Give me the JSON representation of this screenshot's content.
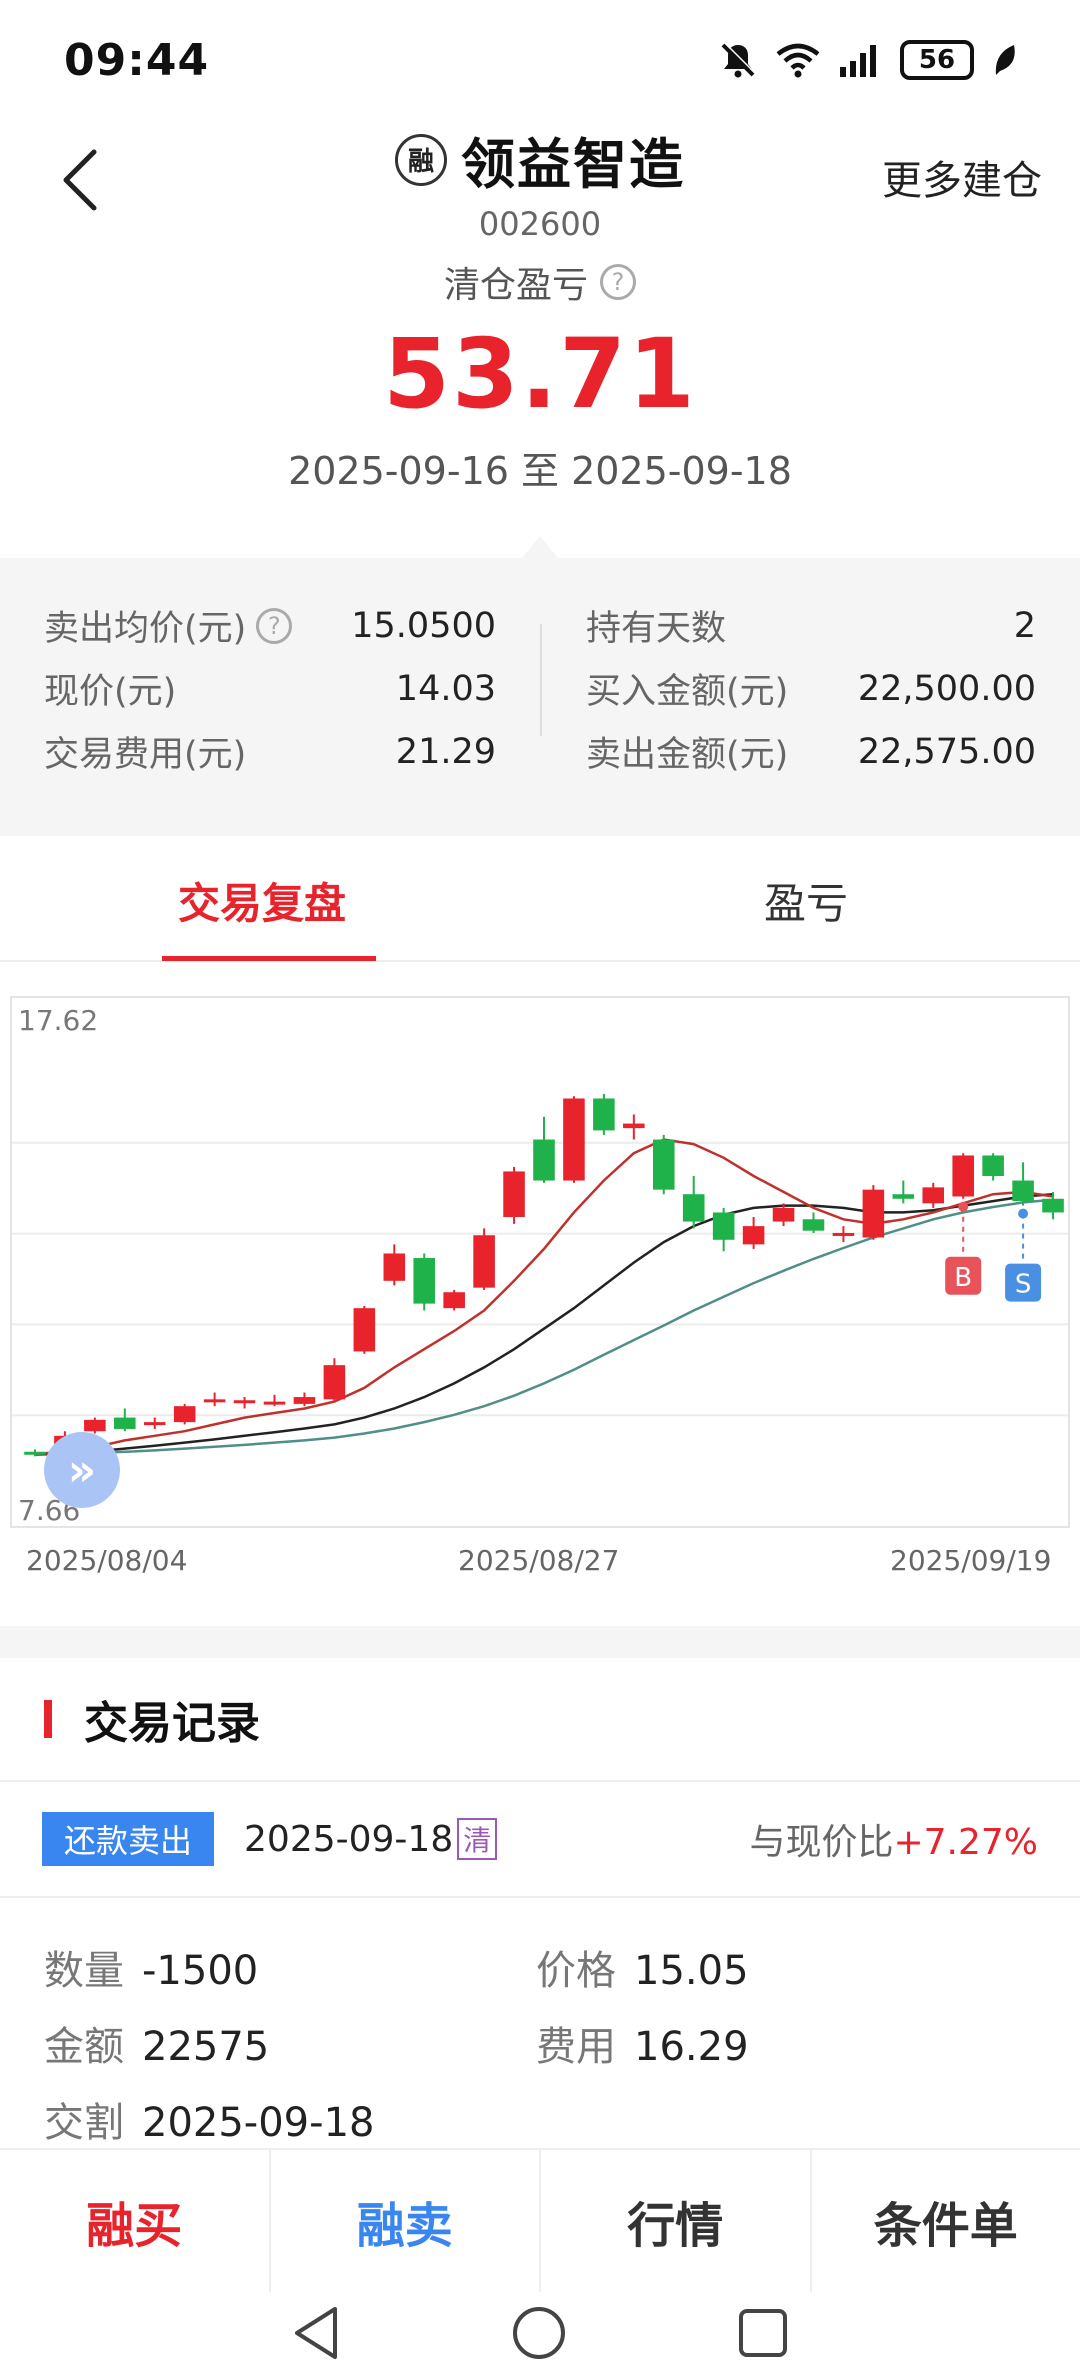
{
  "status_bar": {
    "time": "09:44",
    "battery": "56"
  },
  "header": {
    "stock_name": "领益智造",
    "stock_code": "002600",
    "seal_char": "融",
    "more_label": "更多建仓"
  },
  "summary": {
    "pl_label": "清仓盈亏",
    "pl_value": "53.71",
    "date_range": "2025-09-16 至 2025-09-18"
  },
  "stats": {
    "left": [
      {
        "label": "卖出均价(元)",
        "value": "15.0500",
        "help": true
      },
      {
        "label": "现价(元)",
        "value": "14.03"
      },
      {
        "label": "交易费用(元)",
        "value": "21.29"
      }
    ],
    "right": [
      {
        "label": "持有天数",
        "value": "2"
      },
      {
        "label": "买入金额(元)",
        "value": "22,500.00"
      },
      {
        "label": "卖出金额(元)",
        "value": "22,575.00"
      }
    ]
  },
  "tabs": {
    "replay": "交易复盘",
    "profit": "盈亏"
  },
  "chart_data": {
    "type": "candlestick",
    "ylim": [
      7.66,
      17.62
    ],
    "y_max_label": "17.62",
    "y_min_label": "7.66",
    "x_labels": [
      "2025/08/04",
      "2025/08/27",
      "2025/09/19"
    ],
    "candles": [
      {
        "o": 8.85,
        "c": 8.8,
        "h": 8.9,
        "l": 8.75
      },
      {
        "o": 8.95,
        "c": 9.2,
        "h": 9.3,
        "l": 8.9
      },
      {
        "o": 9.3,
        "c": 9.55,
        "h": 9.6,
        "l": 9.25
      },
      {
        "o": 9.6,
        "c": 9.35,
        "h": 9.8,
        "l": 9.3
      },
      {
        "o": 9.45,
        "c": 9.5,
        "h": 9.6,
        "l": 9.35
      },
      {
        "o": 9.5,
        "c": 9.85,
        "h": 9.9,
        "l": 9.45
      },
      {
        "o": 9.95,
        "c": 10.0,
        "h": 10.15,
        "l": 9.85
      },
      {
        "o": 9.95,
        "c": 9.98,
        "h": 10.05,
        "l": 9.8
      },
      {
        "o": 9.95,
        "c": 9.95,
        "h": 10.1,
        "l": 9.85
      },
      {
        "o": 9.9,
        "c": 10.05,
        "h": 10.15,
        "l": 9.85
      },
      {
        "o": 10.0,
        "c": 10.75,
        "h": 10.9,
        "l": 9.95
      },
      {
        "o": 11.05,
        "c": 12.0,
        "h": 12.05,
        "l": 11.0
      },
      {
        "o": 12.6,
        "c": 13.2,
        "h": 13.4,
        "l": 12.5
      },
      {
        "o": 13.1,
        "c": 12.1,
        "h": 13.2,
        "l": 11.95
      },
      {
        "o": 12.0,
        "c": 12.35,
        "h": 12.4,
        "l": 11.95
      },
      {
        "o": 12.45,
        "c": 13.6,
        "h": 13.75,
        "l": 12.4
      },
      {
        "o": 14.0,
        "c": 15.0,
        "h": 15.1,
        "l": 13.85
      },
      {
        "o": 15.7,
        "c": 14.8,
        "h": 16.2,
        "l": 14.75
      },
      {
        "o": 14.8,
        "c": 16.6,
        "h": 16.65,
        "l": 14.75
      },
      {
        "o": 16.6,
        "c": 15.9,
        "h": 16.7,
        "l": 15.8
      },
      {
        "o": 15.95,
        "c": 16.05,
        "h": 16.25,
        "l": 15.7
      },
      {
        "o": 15.7,
        "c": 14.6,
        "h": 15.8,
        "l": 14.5
      },
      {
        "o": 14.5,
        "c": 13.9,
        "h": 14.9,
        "l": 13.75
      },
      {
        "o": 14.1,
        "c": 13.5,
        "h": 14.2,
        "l": 13.25
      },
      {
        "o": 13.4,
        "c": 13.8,
        "h": 14.0,
        "l": 13.3
      },
      {
        "o": 13.9,
        "c": 14.2,
        "h": 14.3,
        "l": 13.8
      },
      {
        "o": 13.95,
        "c": 13.7,
        "h": 14.1,
        "l": 13.65
      },
      {
        "o": 13.6,
        "c": 13.65,
        "h": 13.8,
        "l": 13.45
      },
      {
        "o": 13.55,
        "c": 14.6,
        "h": 14.7,
        "l": 13.5
      },
      {
        "o": 14.5,
        "c": 14.4,
        "h": 14.8,
        "l": 14.3
      },
      {
        "o": 14.3,
        "c": 14.65,
        "h": 14.75,
        "l": 14.2
      },
      {
        "o": 14.45,
        "c": 15.35,
        "h": 15.4,
        "l": 14.4
      },
      {
        "o": 15.35,
        "c": 14.9,
        "h": 15.4,
        "l": 14.8
      },
      {
        "o": 14.8,
        "c": 14.35,
        "h": 15.2,
        "l": 14.25
      },
      {
        "o": 14.4,
        "c": 14.1,
        "h": 14.55,
        "l": 13.95
      }
    ],
    "ma_short": [
      8.8,
      8.85,
      8.95,
      9.1,
      9.2,
      9.3,
      9.45,
      9.6,
      9.7,
      9.8,
      9.95,
      10.25,
      10.7,
      11.1,
      11.5,
      11.95,
      12.6,
      13.3,
      14.1,
      14.8,
      15.4,
      15.7,
      15.6,
      15.3,
      14.9,
      14.55,
      14.2,
      13.95,
      13.85,
      13.95,
      14.1,
      14.3,
      14.5,
      14.55,
      14.45
    ],
    "ma_mid": [
      8.8,
      8.82,
      8.86,
      8.92,
      8.98,
      9.05,
      9.12,
      9.2,
      9.28,
      9.36,
      9.45,
      9.6,
      9.8,
      10.05,
      10.35,
      10.7,
      11.1,
      11.55,
      12.0,
      12.5,
      13.0,
      13.45,
      13.8,
      14.05,
      14.2,
      14.25,
      14.25,
      14.2,
      14.1,
      14.1,
      14.15,
      14.25,
      14.35,
      14.45,
      14.5
    ],
    "ma_long": [
      8.78,
      8.8,
      8.82,
      8.85,
      8.88,
      8.92,
      8.96,
      9.0,
      9.05,
      9.1,
      9.16,
      9.25,
      9.36,
      9.5,
      9.66,
      9.85,
      10.08,
      10.35,
      10.65,
      10.98,
      11.3,
      11.62,
      11.95,
      12.25,
      12.55,
      12.82,
      13.08,
      13.32,
      13.55,
      13.75,
      13.95,
      14.1,
      14.22,
      14.32,
      14.38
    ],
    "colors": {
      "up": "#e8232b",
      "down": "#1fb24a",
      "ma_short": "#c0312b",
      "ma_mid": "#222222",
      "ma_long": "#4f8f88"
    },
    "markers": [
      {
        "label": "B",
        "index": 31,
        "color": "#e8535a"
      },
      {
        "label": "S",
        "index": 33,
        "color": "#4a90e2"
      }
    ]
  },
  "records": {
    "title": "交易记录",
    "item": {
      "badge": "还款卖出",
      "date": "2025-09-18",
      "clear_tag": "清",
      "compare_label": "与现价比",
      "compare_value": "+7.27%",
      "quantity_label": "数量",
      "quantity_value": "-1500",
      "price_label": "价格",
      "price_value": "15.05",
      "amount_label": "金额",
      "amount_value": "22575",
      "fee_label": "费用",
      "fee_value": "16.29",
      "settle_label": "交割",
      "settle_value": "2025-09-18"
    }
  },
  "bottom_bar": {
    "margin_buy": "融买",
    "margin_sell": "融卖",
    "quote": "行情",
    "conditional": "条件单"
  }
}
